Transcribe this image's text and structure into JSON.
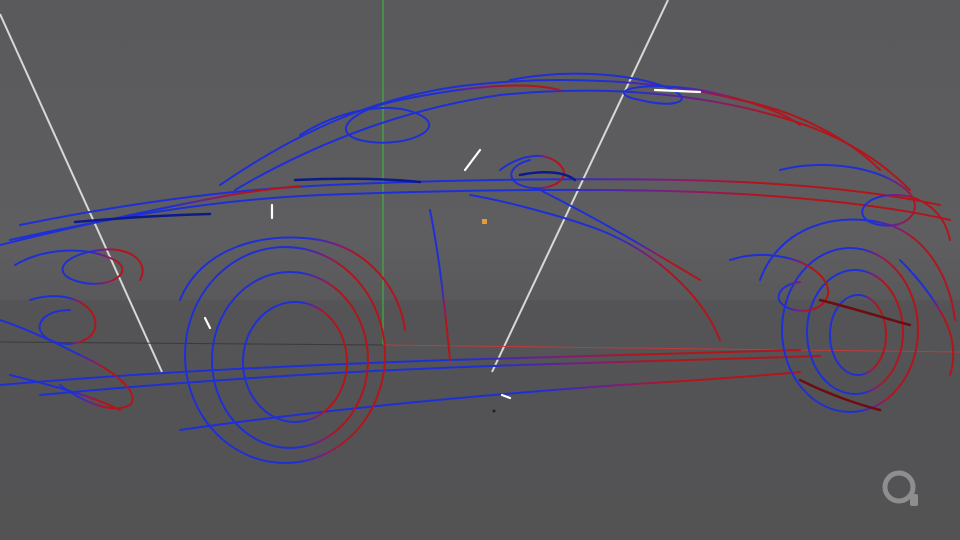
{
  "viewport": {
    "background_color": "#58585a",
    "axis_y_color": "#3fae3f",
    "axis_x_color": "#c23a3a",
    "guide_line_color": "#d8d8d8",
    "stroke_blue": "#1f2fd6",
    "stroke_dark_blue": "#0d1a8a",
    "stroke_red": "#b0161c",
    "stroke_dark_red": "#6e0c10",
    "origin_marker_color": "#e39a3a"
  },
  "watermark": {
    "icon": "logo-ring-icon",
    "color": "#8e8e90"
  }
}
